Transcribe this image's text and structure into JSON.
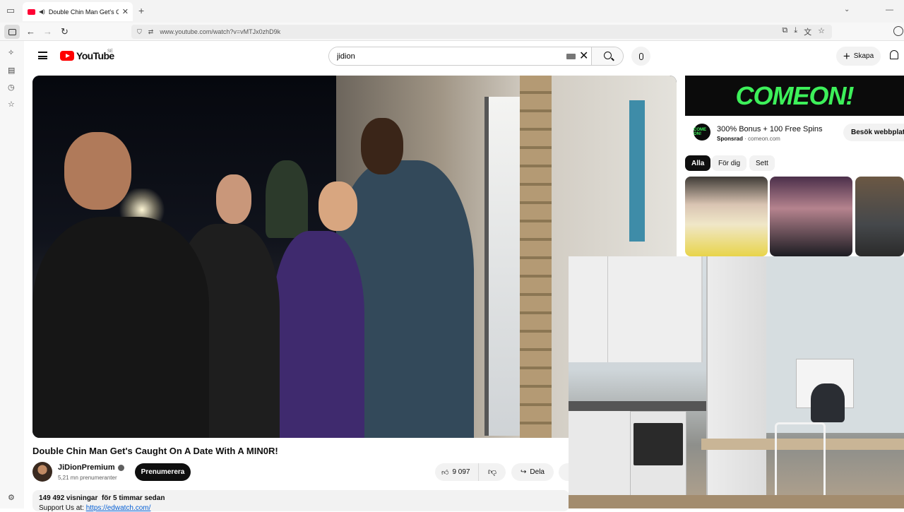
{
  "browser": {
    "tab_title": "Double Chin Man Get's Ca",
    "url": "www.youtube.com/watch?v=vMTJx0zhD9k"
  },
  "youtube": {
    "logo_text": "YouTube",
    "country": "SE",
    "search_value": "jidion",
    "create_label": "Skapa"
  },
  "video": {
    "title": "Double Chin Man Get's Caught On A Date With A MIN0R!",
    "channel": "JiDionPremium",
    "subscribers": "5,21 mn prenumeranter",
    "subscribe_label": "Prenumerera",
    "likes": "9 097",
    "share_label": "Dela",
    "views": "149 492 visningar",
    "age": "för 5 timmar sedan",
    "desc_prefix": "Support Us at: ",
    "desc_link": "https://edwatch.com/"
  },
  "ad": {
    "banner": "COMEON!",
    "logo": "COME ON!",
    "title": "300% Bonus + 100 Free Spins",
    "sponsored": "Sponsrad",
    "domain": "comeon.com",
    "cta": "Besök webbplats"
  },
  "chips": [
    "Alla",
    "För dig",
    "Sett"
  ],
  "colors": {
    "yt_red": "#ff0000",
    "ad_green": "#3df05a",
    "link_blue": "#065fd4"
  }
}
